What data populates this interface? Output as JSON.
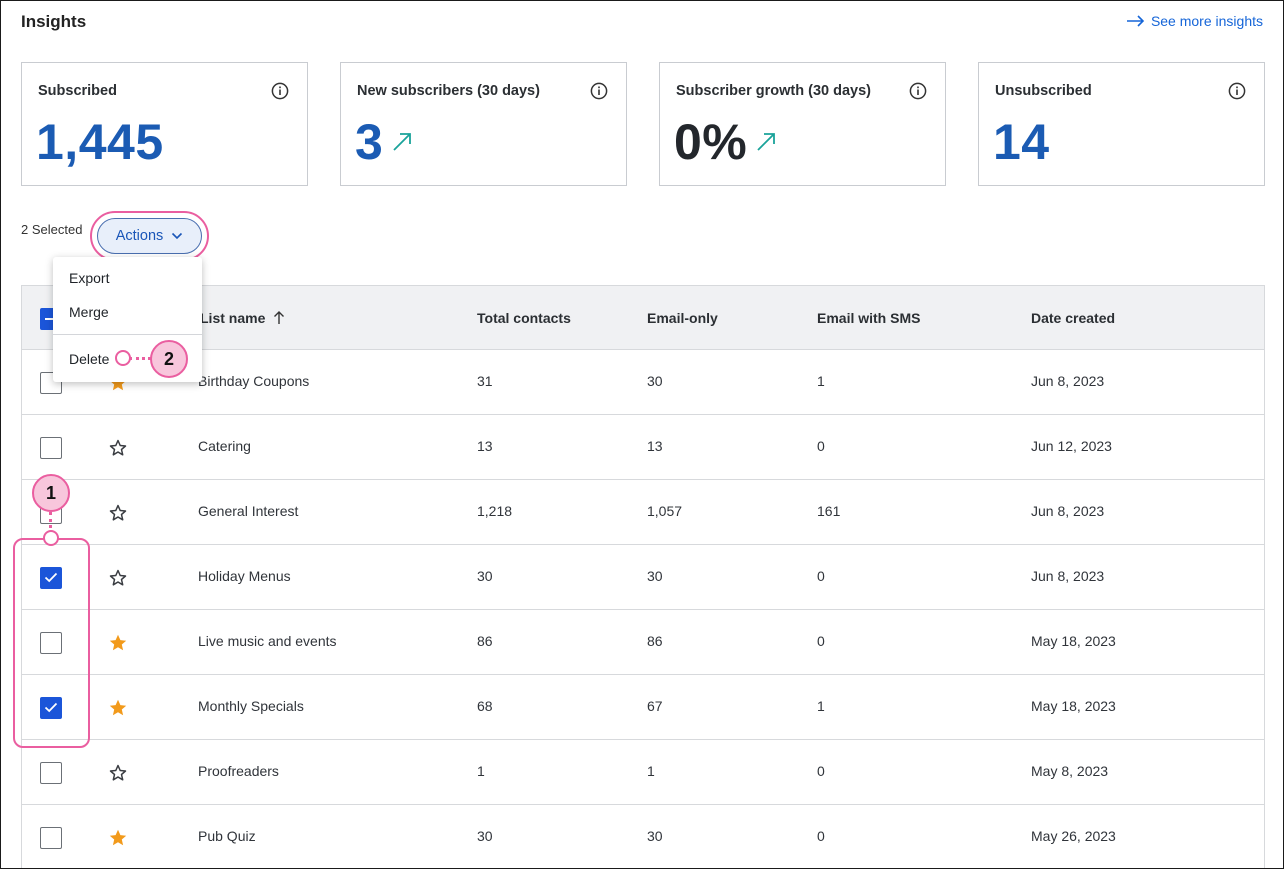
{
  "header": {
    "title": "Insights",
    "see_more": "See more insights"
  },
  "cards": [
    {
      "label": "Subscribed",
      "value": "1,445",
      "trend": false
    },
    {
      "label": "New subscribers (30 days)",
      "value": "3",
      "trend": true
    },
    {
      "label": "Subscriber growth (30 days)",
      "value": "0%",
      "trend": true
    },
    {
      "label": "Unsubscribed",
      "value": "14",
      "trend": false
    }
  ],
  "colors": {
    "accent_blue": "#1b5bb3",
    "checkbox_blue": "#1b55d9",
    "trend_teal": "#1aa39a",
    "star_orange": "#f29a1b",
    "callout_pink": "#ea5ea0"
  },
  "toolbar": {
    "selected_text": "2 Selected",
    "actions_label": "Actions"
  },
  "menu": {
    "items": [
      "Export",
      "Merge",
      "Delete"
    ]
  },
  "table": {
    "columns": [
      "List name",
      "Total contacts",
      "Email-only",
      "Email with SMS",
      "Date created"
    ],
    "rows": [
      {
        "name": "Birthday Coupons",
        "total": "31",
        "email_only": "30",
        "email_sms": "1",
        "date": "Jun 8, 2023",
        "starred": true,
        "checked": false
      },
      {
        "name": "Catering",
        "total": "13",
        "email_only": "13",
        "email_sms": "0",
        "date": "Jun 12, 2023",
        "starred": false,
        "checked": false
      },
      {
        "name": "General Interest",
        "total": "1,218",
        "email_only": "1,057",
        "email_sms": "161",
        "date": "Jun 8, 2023",
        "starred": false,
        "checked": false
      },
      {
        "name": "Holiday Menus",
        "total": "30",
        "email_only": "30",
        "email_sms": "0",
        "date": "Jun 8, 2023",
        "starred": false,
        "checked": true
      },
      {
        "name": "Live music and events",
        "total": "86",
        "email_only": "86",
        "email_sms": "0",
        "date": "May 18, 2023",
        "starred": true,
        "checked": false
      },
      {
        "name": "Monthly Specials",
        "total": "68",
        "email_only": "67",
        "email_sms": "1",
        "date": "May 18, 2023",
        "starred": true,
        "checked": true
      },
      {
        "name": "Proofreaders",
        "total": "1",
        "email_only": "1",
        "email_sms": "0",
        "date": "May 8, 2023",
        "starred": false,
        "checked": false
      },
      {
        "name": "Pub Quiz",
        "total": "30",
        "email_only": "30",
        "email_sms": "0",
        "date": "May 26, 2023",
        "starred": true,
        "checked": false
      }
    ]
  },
  "callouts": [
    "1",
    "2"
  ]
}
